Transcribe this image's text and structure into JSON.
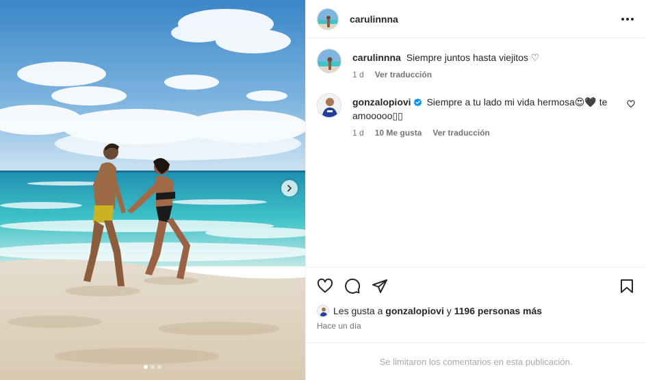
{
  "post": {
    "author": "carulinnna",
    "more_label": "Más opciones"
  },
  "comments": [
    {
      "username": "carulinnna",
      "text": "Siempre juntos hasta viejitos ♡",
      "time": "1 d",
      "likes": "",
      "translate": "Ver traducción",
      "verified": false
    },
    {
      "username": "gonzalopiovi",
      "text": "Siempre a tu lado mi vida hermosa😍🖤 te amooooo▯▯",
      "time": "1 d",
      "likes": "10 Me gusta",
      "translate": "Ver traducción",
      "verified": true
    }
  ],
  "likes": {
    "prefix": "Les gusta a",
    "user": "gonzalopiovi",
    "connector": "y",
    "others": "1196 personas más"
  },
  "timestamp": "Hace un día",
  "comments_limited": "Se limitaron los comentarios en esta publicación.",
  "carousel": {
    "slides": 3,
    "active": 1
  },
  "colors": {
    "verified": "#0095f6",
    "text": "#262626",
    "muted": "#737373",
    "divider": "#efefef"
  }
}
